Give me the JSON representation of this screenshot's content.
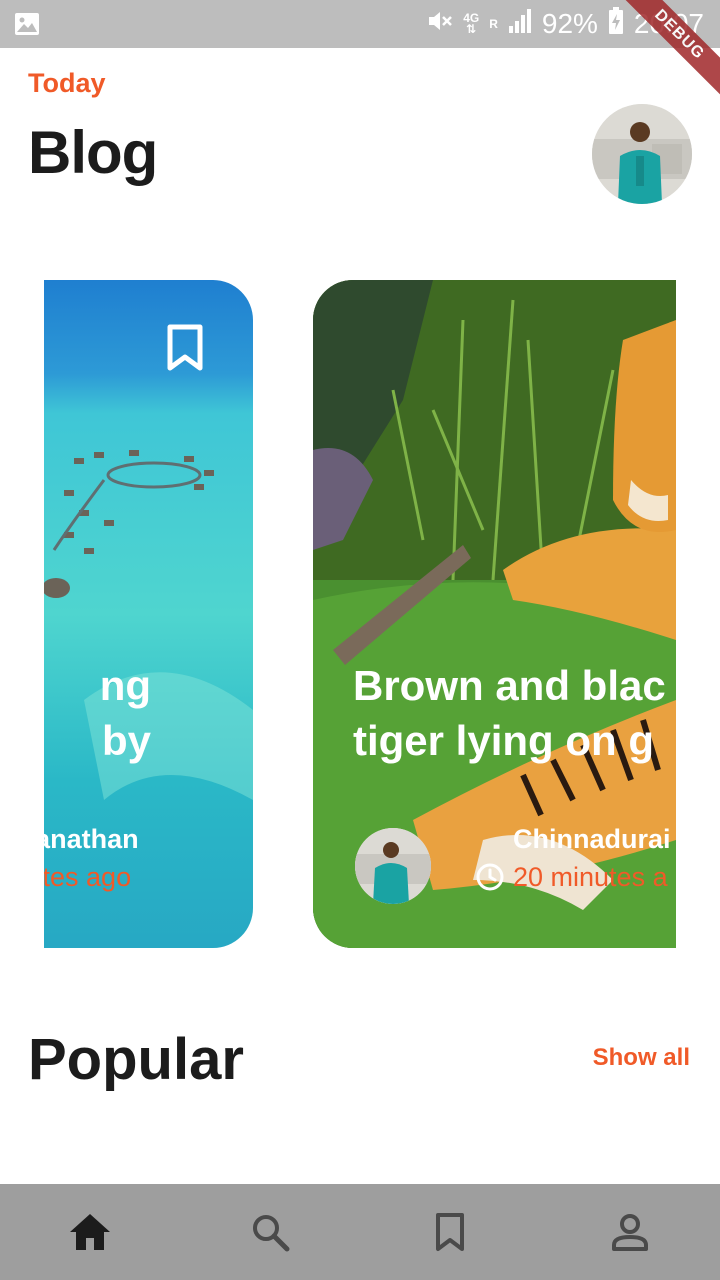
{
  "status_bar": {
    "network_top": "4G",
    "network_sub": "R",
    "battery": "92%",
    "time": "20:07",
    "icons": [
      "image-icon",
      "mute-icon",
      "signal-icon",
      "battery-charging-icon"
    ]
  },
  "debug_banner": "DEBUG",
  "header": {
    "subtitle": "Today",
    "title": "Blog"
  },
  "cards": [
    {
      "title_line1": "ng",
      "title_line2": "by",
      "author": "ai Viswanathan",
      "time": "minutes ago",
      "icon": "bookmark-icon"
    },
    {
      "title_line1": "Brown and blac",
      "title_line2": "tiger lying on g",
      "author": "Chinnadurai",
      "time": "20 minutes a",
      "icon": "clock-icon"
    }
  ],
  "popular": {
    "title": "Popular",
    "show_all": "Show all"
  },
  "bottom_nav": {
    "items": [
      "home-icon",
      "search-icon",
      "bookmark-icon",
      "profile-icon"
    ],
    "active": "home"
  },
  "colors": {
    "accent": "#f05a28",
    "status_bar": "#bdbdbd",
    "bottom_nav": "#9e9e9e",
    "text": "#1c1c1c",
    "debug": "#a0282a"
  }
}
